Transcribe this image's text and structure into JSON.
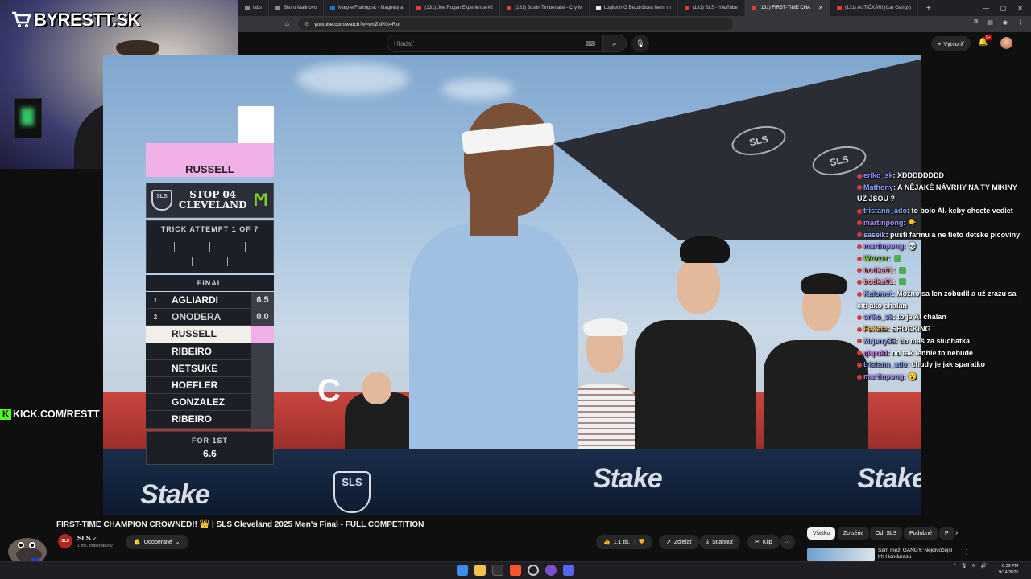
{
  "browser": {
    "tabs": [
      {
        "label": "labs",
        "favicon": "grey"
      },
      {
        "label": "Bistro Malinovo",
        "favicon": "grey"
      },
      {
        "label": "MagnetFishing.sk - Magnety a",
        "favicon": "blue"
      },
      {
        "label": "(131) Joe Rogan Experience #2",
        "favicon": "red"
      },
      {
        "label": "(131) Justin Timberlake - Cry M",
        "favicon": "red"
      },
      {
        "label": "Logitech G Bezdrôtová herní m",
        "favicon": "white"
      },
      {
        "label": "(131) SLS - YouTube",
        "favicon": "red"
      },
      {
        "label": "(131) FIRST-TIME CHA",
        "favicon": "red",
        "active": true
      },
      {
        "label": "(131) AUTIČKÁRI (Car Gangs)",
        "favicon": "red"
      }
    ],
    "new_tab": "+",
    "url": "youtube.com/watch?v=vmZxPIX4RoI"
  },
  "youtube": {
    "search_placeholder": "Hľadať",
    "create_label": "Vytvoriť",
    "notif_count": "9+",
    "video_title": "FIRST-TIME CHAMPION CROWNED!! 👑 | SLS Cleveland 2025 Men's Final - FULL COMPETITION",
    "channel_name": "SLS",
    "channel_avatar_text": "SLS",
    "subscribers": "1 mil. odberateľov",
    "subscribed_label": "Odoberané",
    "likes": "1,1 tis.",
    "share_label": "Zdieľať",
    "download_label": "Stiahnuť",
    "clip_label": "Klip",
    "more": "···",
    "chips": [
      {
        "label": "Všetko",
        "active": true
      },
      {
        "label": "Zo série"
      },
      {
        "label": "Od: SLS"
      },
      {
        "label": "Podobné"
      },
      {
        "label": "P"
      }
    ],
    "rec_title": "Sám mezi GANGY: Nejdivočejší trh Hondurasu"
  },
  "stream": {
    "brand": "BYRESTT.SK",
    "kick": "KICK.COM/RESTT"
  },
  "video": {
    "banner_text": "Stake",
    "banner_sls": "SLS",
    "umbrella_text": "SLS",
    "fence_letter": "C",
    "scoreboard": {
      "current_skater": "RUSSELL",
      "event": "STOP 04",
      "city": "CLEVELAND",
      "sls_badge": "SLS",
      "attempt_label": "TRICK ATTEMPT 1 OF 7",
      "final_label": "FINAL",
      "rows": [
        {
          "pos": "1",
          "name": "AGLIARDI",
          "score": "6.5"
        },
        {
          "pos": "2",
          "name": "ONODERA",
          "score": "0.0"
        },
        {
          "pos": "",
          "name": "RUSSELL",
          "score": "",
          "highlight": true
        },
        {
          "pos": "",
          "name": "RIBEIRO",
          "score": ""
        },
        {
          "pos": "",
          "name": "NETSUKE",
          "score": ""
        },
        {
          "pos": "",
          "name": "HOEFLER",
          "score": ""
        },
        {
          "pos": "",
          "name": "GONZALEZ",
          "score": ""
        },
        {
          "pos": "",
          "name": "RIBEIRO",
          "score": ""
        }
      ],
      "for_label": "FOR 1ST",
      "for_value": "6.6"
    }
  },
  "chat": [
    {
      "user": "eriko_sk",
      "color": "#8f8fff",
      "msg": "XDDDDDDDD"
    },
    {
      "user": "Mathony",
      "color": "#8fa8ff",
      "msg": "A NĚJAKÉ NÁVRHY NA TY MIKINY UŽ JSOU ?"
    },
    {
      "user": "tristann_ado",
      "color": "#7aa7ff",
      "msg": "to bolo AI. keby chcete vediet"
    },
    {
      "user": "martinpong",
      "color": "#a88fff",
      "msg": "👇"
    },
    {
      "user": "saseik",
      "color": "#9fb6ff",
      "msg": "pusti farmu a ne tieto detske picoviny"
    },
    {
      "user": "martinpong",
      "color": "#a88fff",
      "msg": "💀"
    },
    {
      "user": "Wrozer",
      "color": "#7ed321",
      "msg": ""
    },
    {
      "user": "bodka01",
      "color": "#ff8fb0",
      "msg": ""
    },
    {
      "user": "bodka01",
      "color": "#ff8fb0",
      "msg": ""
    },
    {
      "user": "Kalomet",
      "color": "#8fa8ff",
      "msg": "Možno sa len zobudil a už zrazu sa cíti ako chalan"
    },
    {
      "user": "eriko_sk",
      "color": "#8f8fff",
      "msg": "to je AI chalan"
    },
    {
      "user": "FeXate",
      "color": "#ffb347",
      "msg": "SHOCKING"
    },
    {
      "user": "Mrjony36",
      "color": "#9fb6ff",
      "msg": "čo maš za sluchatka"
    },
    {
      "user": "qiqxdd",
      "color": "#e07bff",
      "msg": "no tak tenhle to nebude"
    },
    {
      "user": "tristann_ado",
      "color": "#7aa7ff",
      "msg": "chudy je jak sparatko"
    },
    {
      "user": "martinpong",
      "color": "#a88fff",
      "msg": "😮"
    }
  ],
  "taskbar": {
    "time": "8:39 PM",
    "date": "9/14/2025"
  }
}
